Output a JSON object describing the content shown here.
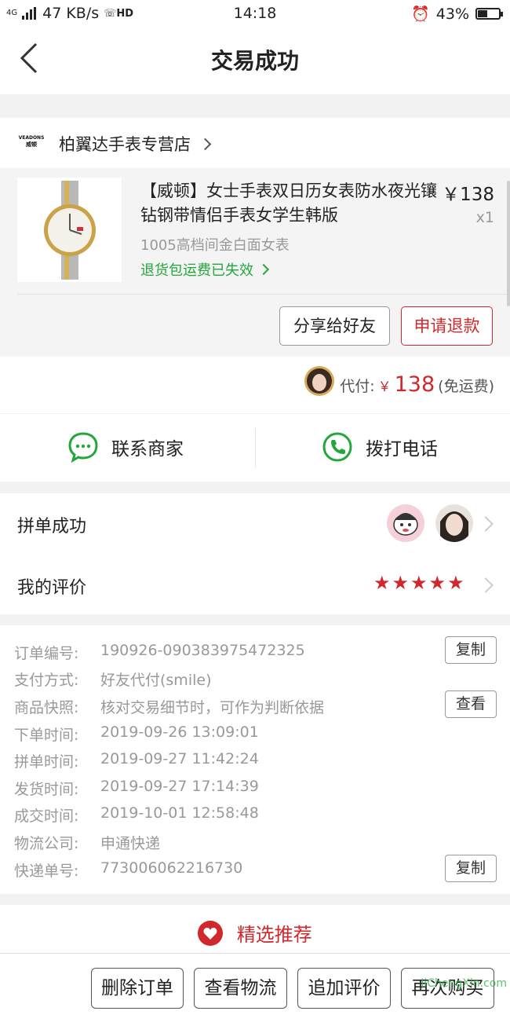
{
  "status_bar": {
    "network": "4G",
    "speed": "47 KB/s",
    "hd": "HD",
    "time": "14:18",
    "battery": "43%"
  },
  "header": {
    "title": "交易成功",
    "back_icon": "chevron-left-icon"
  },
  "shop": {
    "logo_text": "VEADONS",
    "logo_sub": "威顿",
    "name": "柏翼达手表专营店"
  },
  "product": {
    "name": "【威顿】女士手表双日历女表防水夜光镶钻钢带情侣手表女学生韩版",
    "price": "￥138",
    "quantity": "x1",
    "spec": "1005高档间金白面女表",
    "return_note": "退货包运费已失效",
    "share_button": "分享给好友",
    "refund_button": "申请退款"
  },
  "payment": {
    "label": "代付:",
    "currency": "￥",
    "amount": "138",
    "shipping": "(免运费)"
  },
  "contact": {
    "merchant": "联系商家",
    "call": "拨打电话"
  },
  "group": {
    "label": "拼单成功",
    "review_label": "我的评价",
    "stars": "★★★★★"
  },
  "details": {
    "rows": [
      {
        "label": "订单编号:",
        "value": "190926-090383975472325",
        "action": "复制"
      },
      {
        "label": "支付方式:",
        "value": "好友代付(smile)"
      },
      {
        "label": "商品快照:",
        "value": "核对交易细节时，可作为判断依据",
        "action": "查看"
      },
      {
        "label": "下单时间:",
        "value": "2019-09-26 13:09:01"
      },
      {
        "label": "拼单时间:",
        "value": "2019-09-27 11:42:24"
      },
      {
        "label": "发货时间:",
        "value": "2019-09-27 17:14:39"
      },
      {
        "label": "成交时间:",
        "value": "2019-10-01 12:58:48"
      },
      {
        "label": "物流公司:",
        "value": "申通快递"
      },
      {
        "label": "快递单号:",
        "value": "773006062216730",
        "action": "复制"
      }
    ]
  },
  "recommend": {
    "title": "精选推荐"
  },
  "footer": {
    "delete": "删除订单",
    "logistics": "查看物流",
    "add_review": "追加评价",
    "rebuy": "再次购买"
  },
  "watermark": "JiChengXin.com",
  "colors": {
    "accent": "#d0282c",
    "green": "#23a73c",
    "wechat": "#35b34a"
  }
}
